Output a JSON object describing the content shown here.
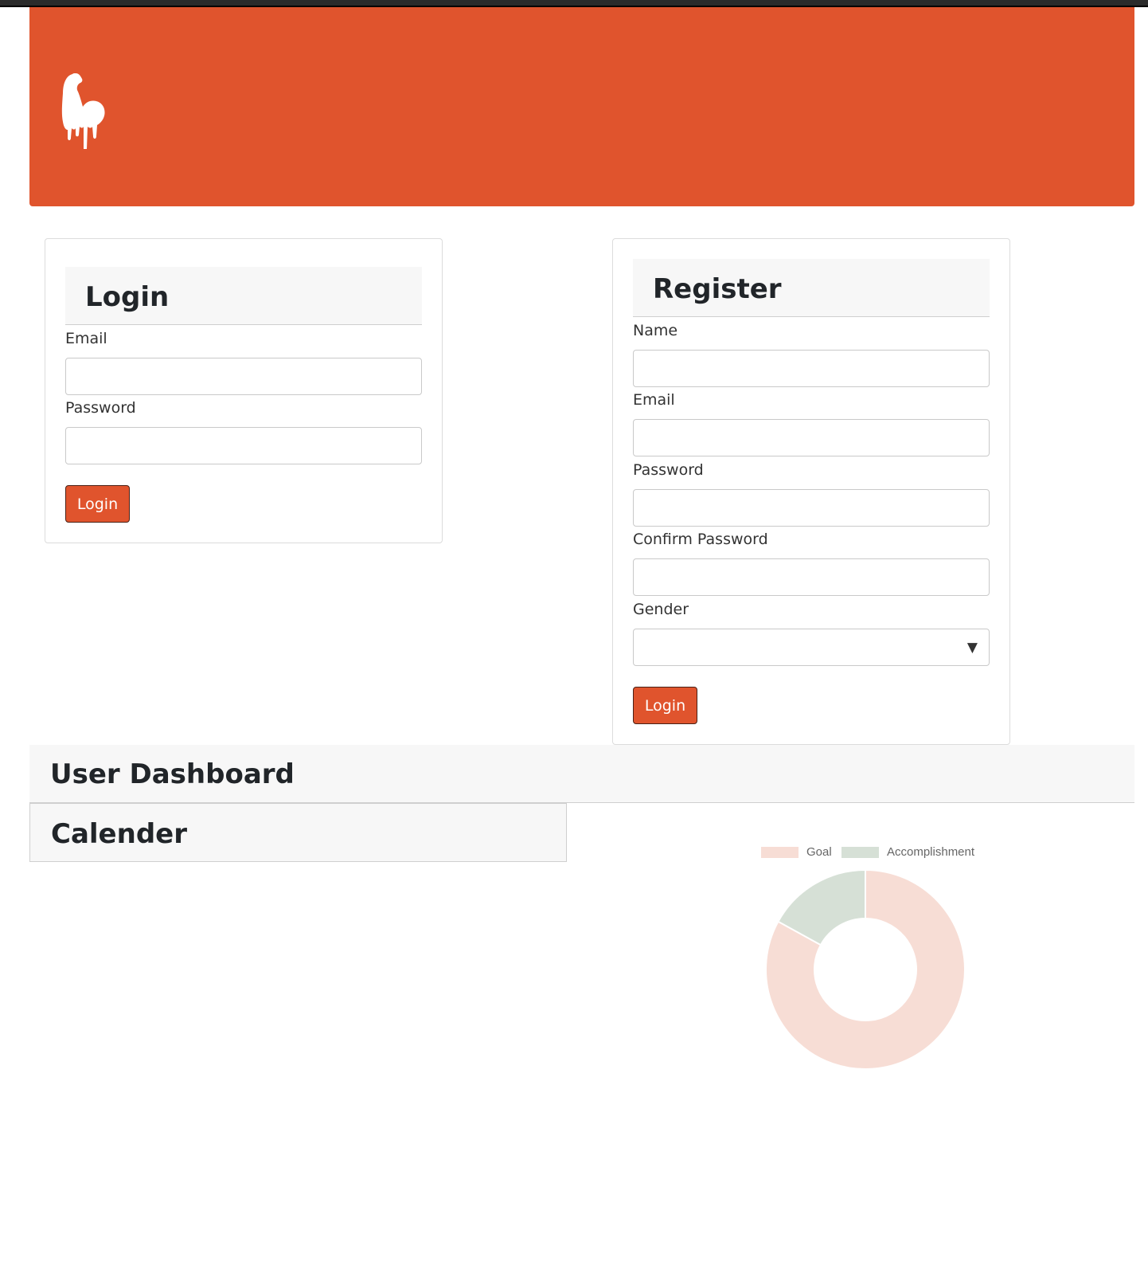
{
  "header": {
    "logo_icon": "flexed-arm-icon",
    "brand_color": "#e0542d"
  },
  "login": {
    "title": "Login",
    "email_label": "Email",
    "email_value": "",
    "password_label": "Password",
    "password_value": "",
    "button_label": "Login"
  },
  "register": {
    "title": "Register",
    "name_label": "Name",
    "name_value": "",
    "email_label": "Email",
    "email_value": "",
    "password_label": "Password",
    "password_value": "",
    "confirm_label": "Confirm Password",
    "confirm_value": "",
    "gender_label": "Gender",
    "gender_value": "",
    "button_label": "Login"
  },
  "dashboard": {
    "title": "User Dashboard"
  },
  "calendar": {
    "title": "Calender"
  },
  "chart_data": {
    "type": "pie",
    "style": "doughnut",
    "labels": [
      "Goal",
      "Accomplishment"
    ],
    "values": [
      83,
      17
    ],
    "colors": [
      "#f7ddd5",
      "#d6e0d6"
    ],
    "legend": "top"
  }
}
